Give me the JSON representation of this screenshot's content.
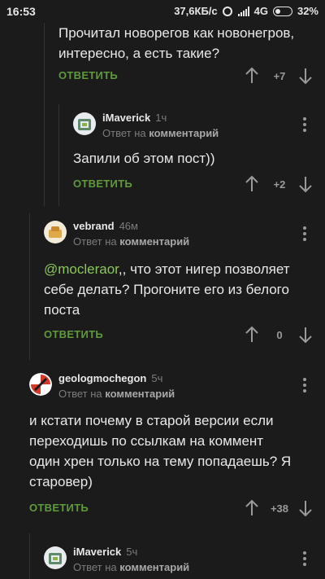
{
  "status_bar": {
    "time": "16:53",
    "speed": "37,6КБ/с",
    "network": "4G",
    "battery": "32%"
  },
  "reply_label": "ОТВЕТИТЬ",
  "comments": [
    {
      "text": "Прочитал новорегов как новонегров,\nинтересно, а есть такие?",
      "rating": "+7"
    },
    {
      "author": "iMaverick",
      "time": "1ч",
      "reply_prefix": "Ответ на",
      "reply_target": "комментарий",
      "text": "Запили об этом пост))",
      "rating": "+2"
    },
    {
      "author": "vebrand",
      "time": "46м",
      "reply_prefix": "Ответ на",
      "reply_target": "комментарий",
      "mention": "@mocleraor",
      "text": ",, что этот нигер позволяет\nсебе делать? Прогоните его из белого\nпоста",
      "rating": "0"
    },
    {
      "author": "geologmochegon",
      "time": "5ч",
      "reply_prefix": "Ответ на",
      "reply_target": "комментарий",
      "text": "и кстати почему в старой версии если\nпереходишь по ссылкам на коммент\nодин хрен только на тему попадаешь? Я\nстаровер)",
      "rating": "+38"
    },
    {
      "author": "iMaverick",
      "time": "5ч",
      "reply_prefix": "Ответ на",
      "reply_target": "комментарий"
    }
  ],
  "colors": {
    "background": "#1b1b1b",
    "reply_green": "#5f9a3b",
    "mention_green": "#8ac858"
  }
}
